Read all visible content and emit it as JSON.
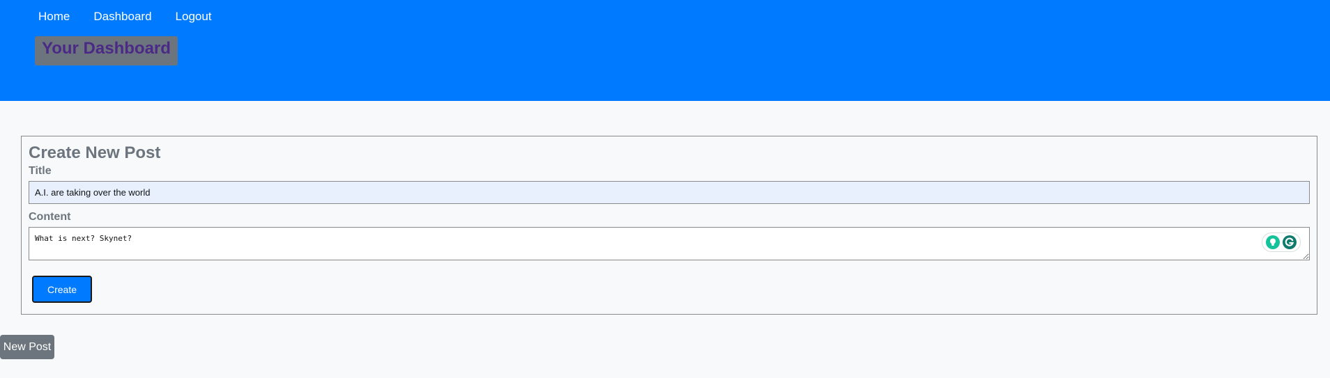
{
  "nav": {
    "items": [
      {
        "label": "Home"
      },
      {
        "label": "Dashboard"
      },
      {
        "label": "Logout"
      }
    ]
  },
  "header": {
    "title": "Your Dashboard"
  },
  "form": {
    "heading": "Create New Post",
    "title_label": "Title",
    "title_value": "A.I. are taking over the world",
    "content_label": "Content",
    "content_value": "What is next? Skynet?",
    "submit_label": "Create"
  },
  "extension": {
    "icons": [
      "lightbulb-icon",
      "grammarly-icon"
    ],
    "accent_color": "#15c39a"
  },
  "new_post_button": {
    "label": "New Post"
  },
  "colors": {
    "header_bg": "#007bff",
    "page_bg": "#f8f9fa",
    "muted": "#6c757d",
    "title_text": "#4b2a86",
    "primary": "#007bff"
  }
}
